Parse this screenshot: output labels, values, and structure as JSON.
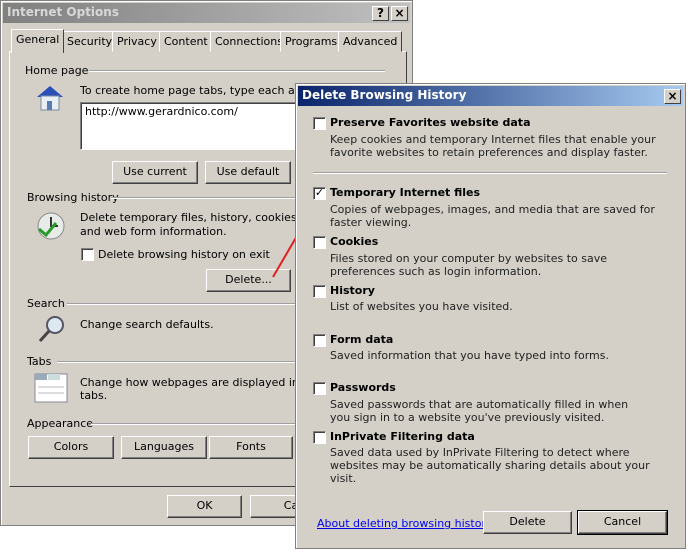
{
  "internet_options": {
    "title": "Internet Options",
    "help_label": "?",
    "close_label": "×",
    "tabs": [
      "General",
      "Security",
      "Privacy",
      "Content",
      "Connections",
      "Programs",
      "Advanced"
    ],
    "home_page": {
      "group": "Home page",
      "instruction": "To create home page tabs, type each addres",
      "url": "http://www.gerardnico.com/",
      "use_current": "Use current",
      "use_default": "Use default"
    },
    "browsing_history": {
      "group": "Browsing history",
      "desc": "Delete temporary files, history, cookies, save",
      "desc2": "and web form information.",
      "checkbox": "Delete browsing history on exit",
      "delete": "Delete..."
    },
    "search": {
      "group": "Search",
      "desc": "Change search defaults."
    },
    "tabs_group": {
      "group": "Tabs",
      "desc": "Change how webpages are displayed in",
      "desc2": "tabs."
    },
    "appearance": {
      "group": "Appearance",
      "colors": "Colors",
      "languages": "Languages",
      "fonts": "Fonts"
    },
    "ok": "OK",
    "cancel": "Cance"
  },
  "delete_dialog": {
    "title": "Delete Browsing History",
    "close_label": "×",
    "options": [
      {
        "label": "Preserve Favorites website data",
        "desc": "Keep cookies and temporary Internet files that enable your favorite websites to retain preferences and display faster.",
        "checked": false
      },
      {
        "label": "Temporary Internet files",
        "desc": "Copies of webpages, images, and media that are saved for faster viewing.",
        "checked": true
      },
      {
        "label": "Cookies",
        "desc": "Files stored on your computer by websites to save preferences such as login information.",
        "checked": false
      },
      {
        "label": "History",
        "desc": "List of websites you have visited.",
        "checked": false
      },
      {
        "label": "Form data",
        "desc": "Saved information that you have typed into forms.",
        "checked": false
      },
      {
        "label": "Passwords",
        "desc": "Saved passwords that are automatically filled in when you sign in to a website you've previously visited.",
        "checked": false
      },
      {
        "label": "InPrivate Filtering data",
        "desc": "Saved data used by InPrivate Filtering to detect where websites may be automatically sharing details about your visit.",
        "checked": false
      }
    ],
    "about_link": "About deleting browsing history",
    "delete": "Delete",
    "cancel": "Cancel",
    "check_mark": "✓"
  },
  "colors": {
    "title_active": "#0a246a",
    "title_inactive": "#808080",
    "link": "#0000ee",
    "arrow": "#e02020"
  }
}
